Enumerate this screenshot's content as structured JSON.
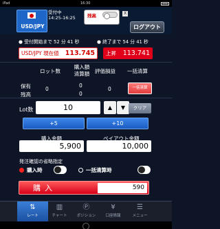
{
  "status_bar": {
    "left": "iPad",
    "time": "16:30",
    "right": ""
  },
  "pair": {
    "label": "USD/JPY"
  },
  "session": {
    "label": "受付中",
    "hours": "14:25-16:25"
  },
  "zandaka_toggle": {
    "label": "残高"
  },
  "close_label": "X",
  "logout_label": "ログアウト",
  "countdown": {
    "start": "● 受付開始まで 52 分 41 秒",
    "end": "● 終了まで 54 分 41 秒"
  },
  "current_price": {
    "label": "USD/JPY 現在値",
    "value": "113.745"
  },
  "limit_price": {
    "label": "上昇",
    "value": "113.741"
  },
  "table": {
    "headers": {
      "lots": "ロット数",
      "buy_line1": "購入額",
      "buy_line2": "清算額",
      "pl": "評価損益",
      "bulk": "一括清算"
    },
    "row_label_line1": "保有",
    "row_label_line2": "残高",
    "values": {
      "lots": "0",
      "buy": "0",
      "settle": "0",
      "pl": "0"
    },
    "bulk_button_label": "一括清算"
  },
  "lot": {
    "label": "Lot数",
    "value": "10",
    "up_label": "▲",
    "down_label": "▼",
    "clear_label": "クリア"
  },
  "plus_buttons": [
    "+5",
    "+10"
  ],
  "amounts": {
    "buy_label": "購入金額",
    "buy_value": "5,900",
    "payout_label": "ペイアウト金額",
    "payout_value": "10,000"
  },
  "confirm": {
    "title": "発注確認の省略指定",
    "buy_time_label": "購入時",
    "bulk_label": "一括清算時"
  },
  "buy": {
    "label": "購入",
    "price": "590"
  },
  "tabs": [
    {
      "label": "レート",
      "icon": "⇅"
    },
    {
      "label": "チャート",
      "icon": "▥"
    },
    {
      "label": "ポジション",
      "icon": "Ⓟ"
    },
    {
      "label": "口座情報",
      "icon": "¥"
    },
    {
      "label": "メニュー",
      "icon": "☰"
    }
  ],
  "colors": {
    "accent_red": "#e0001a",
    "accent_blue": "#1e66c8",
    "background": "#0d1526"
  }
}
